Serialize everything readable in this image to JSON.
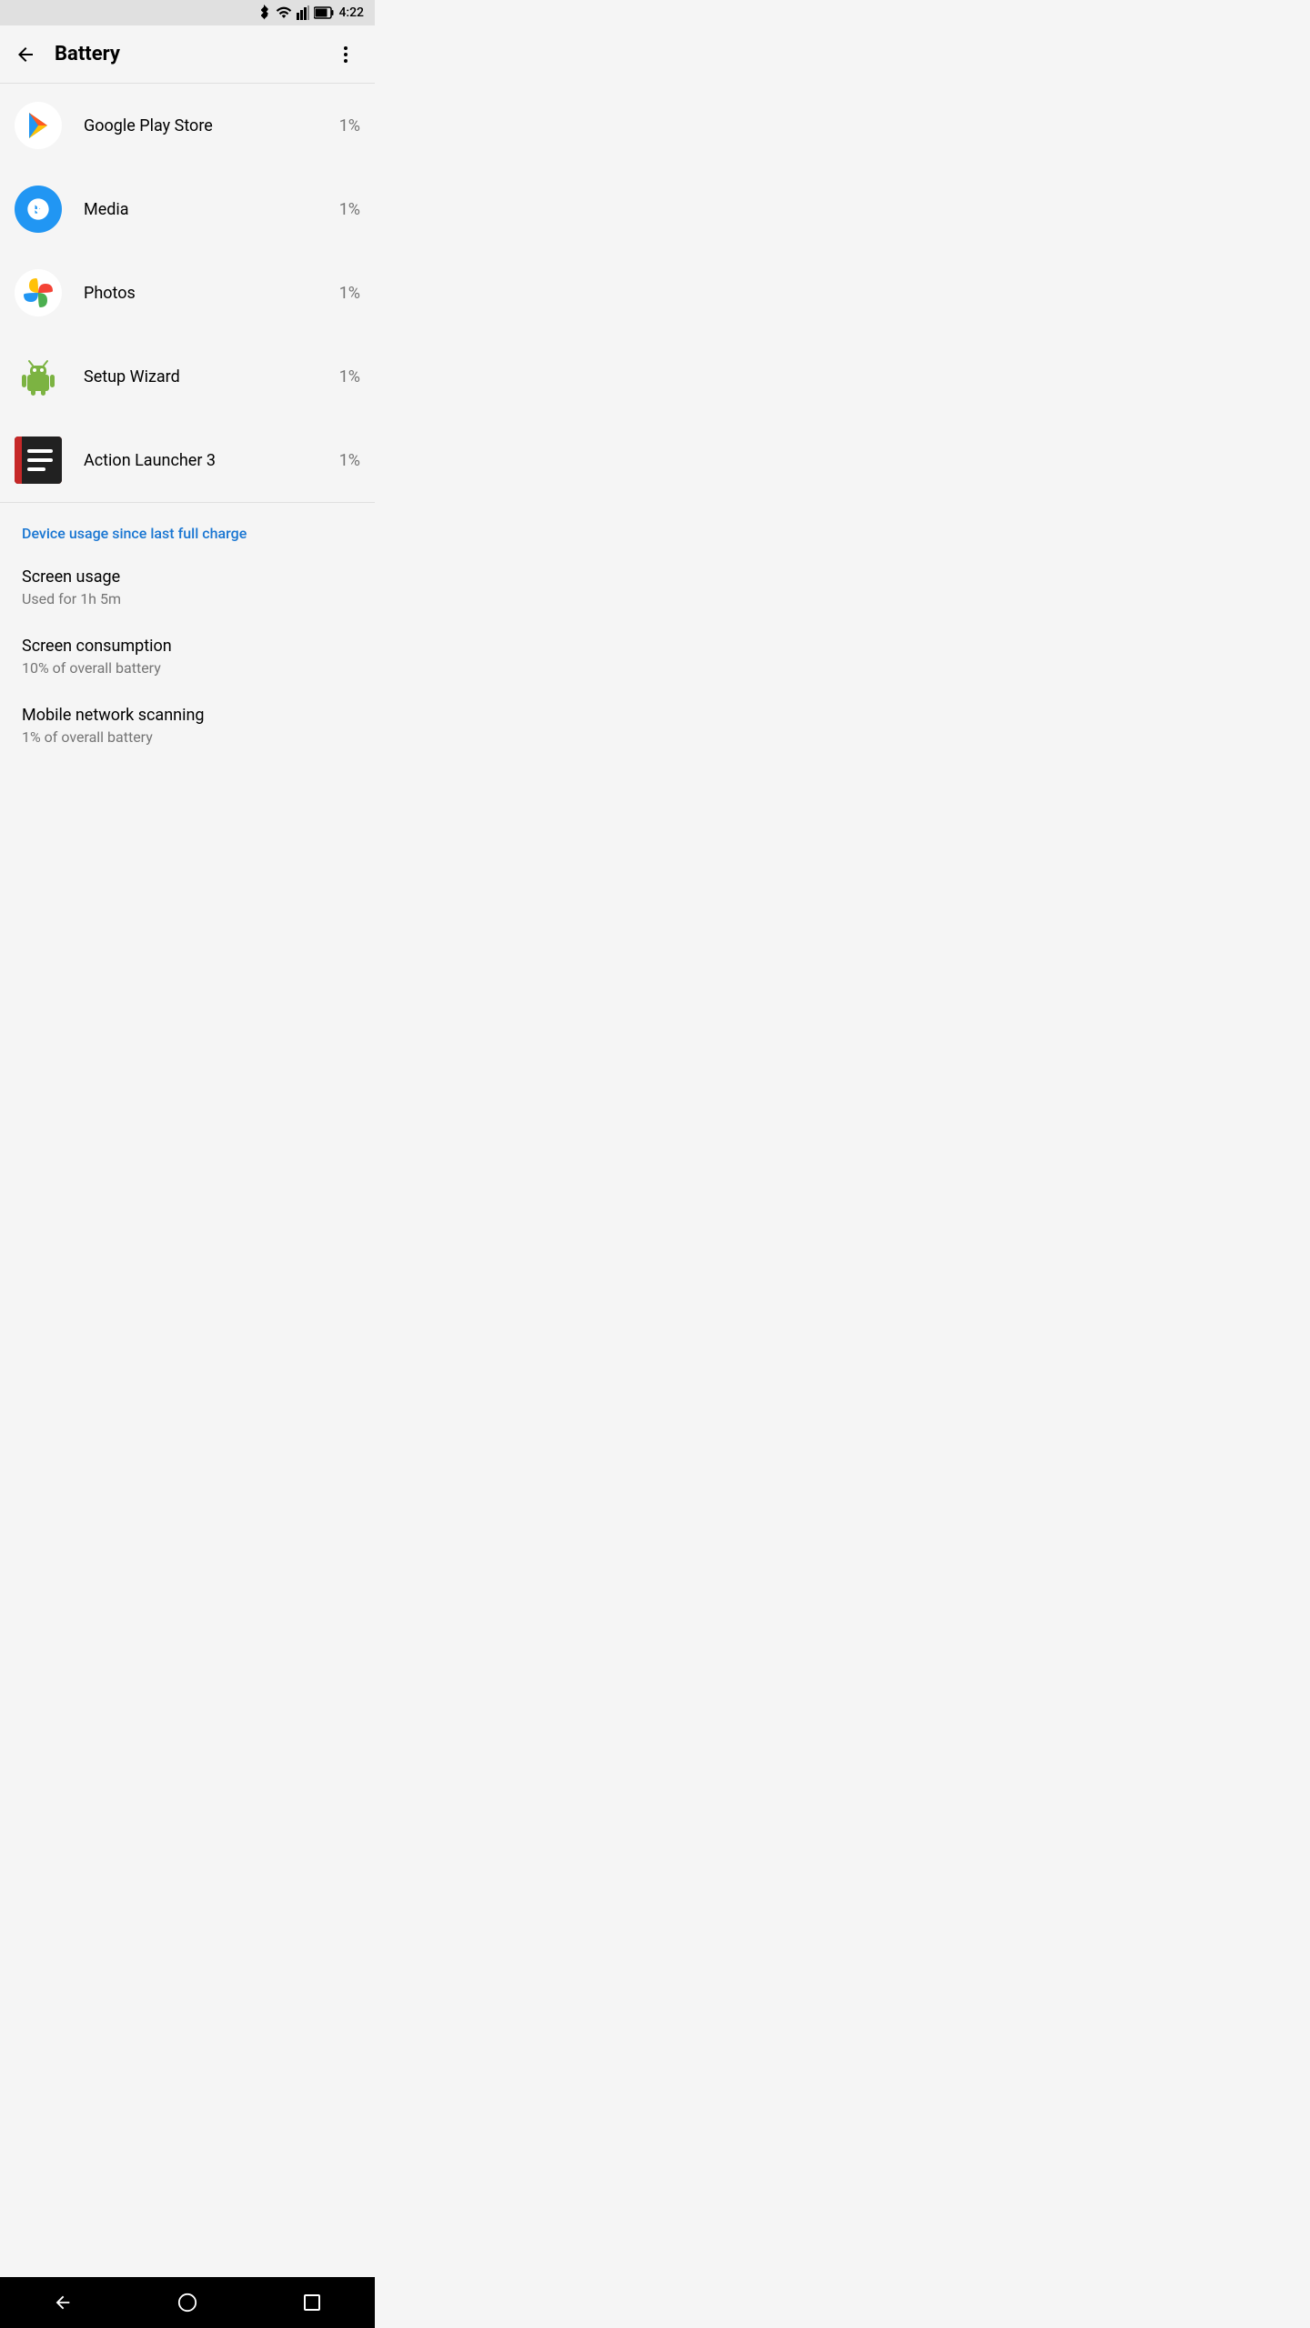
{
  "statusBar": {
    "time": "4:22",
    "batteryIcon": "battery",
    "wifiIcon": "wifi",
    "signalIcon": "signal",
    "bluetoothIcon": "bluetooth"
  },
  "appBar": {
    "title": "Battery",
    "backLabel": "back",
    "moreLabel": "more options"
  },
  "apps": [
    {
      "name": "Google Play Store",
      "percent": "1%",
      "iconType": "play"
    },
    {
      "name": "Media",
      "percent": "1%",
      "iconType": "media"
    },
    {
      "name": "Photos",
      "percent": "1%",
      "iconType": "photos"
    },
    {
      "name": "Setup Wizard",
      "percent": "1%",
      "iconType": "setup"
    },
    {
      "name": "Action Launcher 3",
      "percent": "1%",
      "iconType": "launcher"
    }
  ],
  "deviceUsage": {
    "sectionTitle": "Device usage since last full charge",
    "items": [
      {
        "title": "Screen usage",
        "subtitle": "Used for 1h 5m"
      },
      {
        "title": "Screen consumption",
        "subtitle": "10% of overall battery"
      },
      {
        "title": "Mobile network scanning",
        "subtitle": "1% of overall battery"
      }
    ]
  },
  "navBar": {
    "backLabel": "back",
    "homeLabel": "home",
    "recentsLabel": "recents"
  }
}
